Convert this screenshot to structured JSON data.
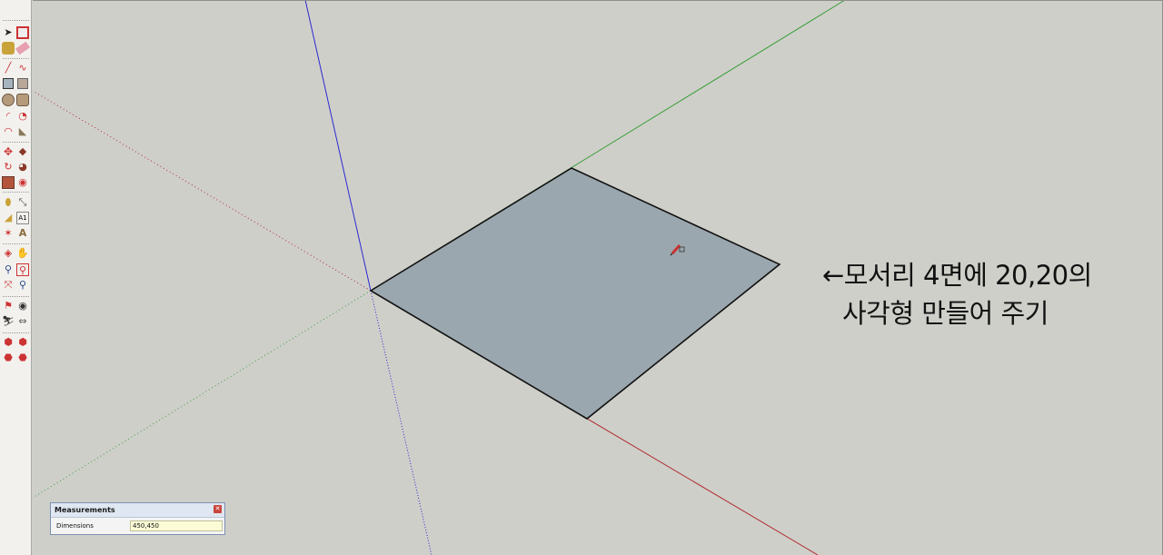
{
  "annotation": {
    "line1": "←모서리 4면에 20,20의",
    "line2": "사각형 만들어 주기"
  },
  "measurements": {
    "title": "Measurements",
    "label": "Dimensions",
    "value": "450,450",
    "close": "✕"
  },
  "colors": {
    "face": "#9ba7ae",
    "red_axis": "#b03030",
    "green_axis": "#3aa03a",
    "blue_axis": "#2a2ad0",
    "background": "#cfcfca"
  },
  "tools": [
    "select-tool-icon",
    "make-component-tool-icon",
    "paint-bucket-tool-icon",
    "eraser-tool-icon",
    "line-tool-icon",
    "freehand-tool-icon",
    "rectangle-tool-icon",
    "rotated-rectangle-tool-icon",
    "circle-tool-icon",
    "polygon-tool-icon",
    "arc-tool-icon",
    "pie-tool-icon",
    "three-point-arc-tool-icon",
    "two-point-arc-tool-icon",
    "move-tool-icon",
    "push-pull-tool-icon",
    "rotate-tool-icon",
    "follow-me-tool-icon",
    "scale-tool-icon",
    "offset-tool-icon",
    "tape-measure-tool-icon",
    "dimension-tool-icon",
    "protractor-tool-icon",
    "text-tool-icon",
    "axes-tool-icon",
    "3d-text-tool-icon",
    "orbit-tool-icon",
    "pan-tool-icon",
    "zoom-tool-icon",
    "zoom-window-tool-icon",
    "zoom-extents-tool-icon",
    "previous-view-tool-icon",
    "position-camera-tool-icon",
    "look-around-tool-icon",
    "walk-tool-icon",
    "section-plane-tool-icon",
    "warehouse-tool-icon",
    "share-model-tool-icon",
    "extension-warehouse-tool-icon",
    "extension-manager-tool-icon"
  ]
}
